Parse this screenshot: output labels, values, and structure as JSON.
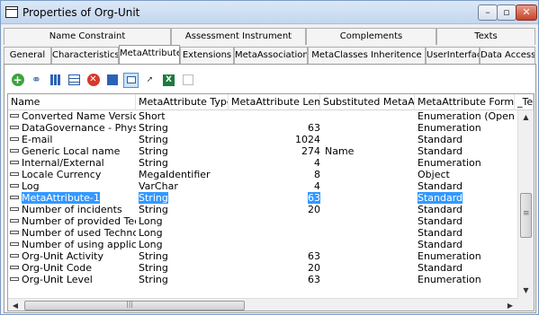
{
  "window": {
    "title": "Properties of Org-Unit",
    "minimize": "–",
    "maximize": "▫",
    "close": "✕"
  },
  "tabs_row1": [
    "Name Constraint",
    "Assessment Instrument",
    "Complements",
    "Texts"
  ],
  "tabs_row2": [
    "General",
    "Characteristics",
    "MetaAttribute",
    "Extensions",
    "MetaAssociation",
    "MetaClasses Inheritence",
    "UserInterface",
    "Data Access"
  ],
  "active_tab": "MetaAttribute",
  "toolbar": {
    "icons": [
      "add-icon",
      "link-icon",
      "properties-icon",
      "list-icon",
      "delete-icon",
      "sort-icon",
      "select-icon",
      "pin-icon",
      "excel-icon",
      "disabled-icon"
    ]
  },
  "table": {
    "columns": [
      "Name",
      "MetaAttribute Type",
      "MetaAttribute Length",
      "Substituted MetaAttri...",
      "MetaAttribute Format",
      "_Text"
    ],
    "rows": [
      [
        "Converted Name Version",
        "Short",
        "",
        "",
        "Enumeration (Opened)"
      ],
      [
        "DataGovernance - Physica",
        "String",
        "63",
        "",
        "Enumeration"
      ],
      [
        "E-mail",
        "String",
        "1024",
        "",
        "Standard"
      ],
      [
        "Generic Local name",
        "String",
        "274",
        "Name",
        "Standard"
      ],
      [
        "Internal/External",
        "String",
        "4",
        "",
        "Enumeration"
      ],
      [
        "Locale Currency",
        "MegaIdentifier",
        "8",
        "",
        "Object"
      ],
      [
        "Log",
        "VarChar",
        "4",
        "",
        "Standard"
      ],
      [
        "MetaAttribute-1",
        "String",
        "63",
        "",
        "Standard"
      ],
      [
        "Number of incidents",
        "String",
        "20",
        "",
        "Standard"
      ],
      [
        "Number of provided Tech",
        "Long",
        "",
        "",
        "Standard"
      ],
      [
        "Number of used Technolo",
        "Long",
        "",
        "",
        "Standard"
      ],
      [
        "Number of using applicati",
        "Long",
        "",
        "",
        "Standard"
      ],
      [
        "Org-Unit Activity",
        "String",
        "63",
        "",
        "Enumeration"
      ],
      [
        "Org-Unit Code",
        "String",
        "20",
        "",
        "Standard"
      ],
      [
        "Org-Unit Level",
        "String",
        "63",
        "",
        "Enumeration"
      ]
    ],
    "highlighted_row": "MetaAttribute-1"
  },
  "colors": {
    "selection": "#3399ff",
    "titlebar": "#c3d6ef",
    "close_button": "#c4432a"
  }
}
